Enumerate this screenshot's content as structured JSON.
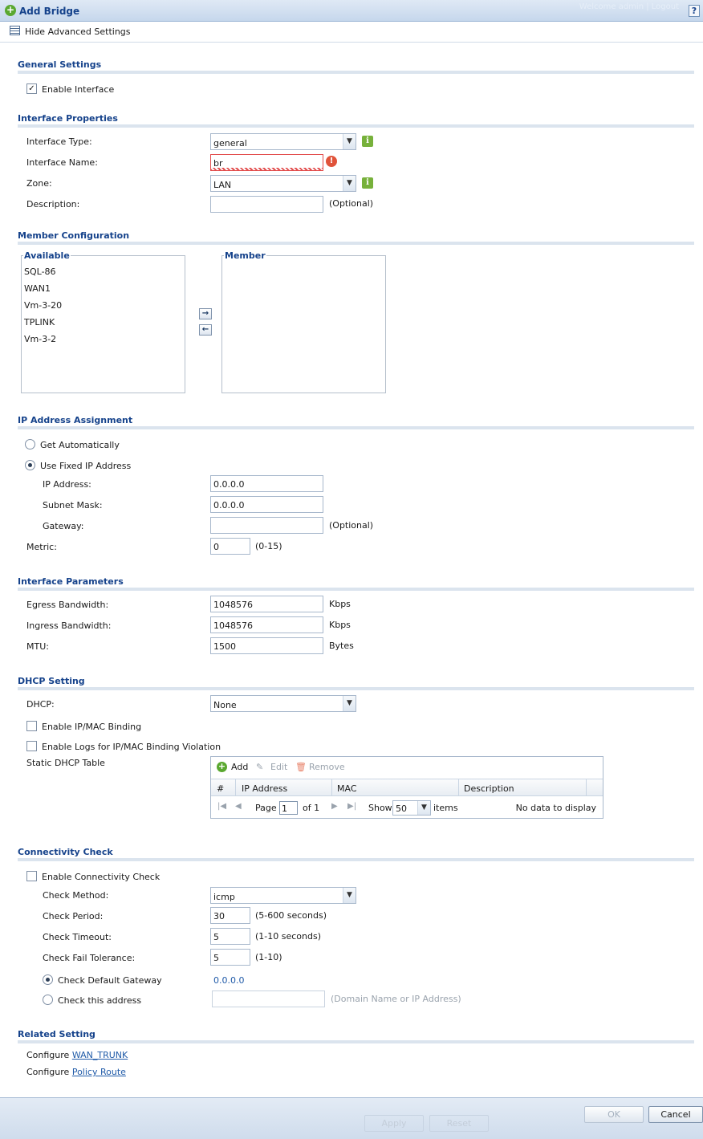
{
  "window": {
    "title": "Add Bridge",
    "help_label": "?",
    "faint_text": "Welcome admin | Logout"
  },
  "toolbar": {
    "advanced_label": "Hide Advanced Settings"
  },
  "general": {
    "title": "General Settings",
    "enable_interface": "Enable Interface",
    "enable_checked": true
  },
  "iface_props": {
    "title": "Interface Properties",
    "type_label": "Interface Type:",
    "type_value": "general",
    "name_label": "Interface Name:",
    "name_value": "br",
    "zone_label": "Zone:",
    "zone_value": "LAN",
    "desc_label": "Description:",
    "desc_value": "",
    "optional": "(Optional)"
  },
  "member": {
    "title": "Member Configuration",
    "available_label": "Available",
    "member_label": "Member",
    "available": [
      "SQL-86",
      "WAN1",
      "Vm-3-20",
      "TPLINK",
      "Vm-3-2"
    ]
  },
  "ip": {
    "title": "IP Address Assignment",
    "get_auto": "Get Automatically",
    "use_fixed": "Use Fixed IP Address",
    "ip_label": "IP Address:",
    "ip_value": "0.0.0.0",
    "mask_label": "Subnet Mask:",
    "mask_value": "0.0.0.0",
    "gw_label": "Gateway:",
    "gw_value": "",
    "gw_hint": "(Optional)",
    "metric_label": "Metric:",
    "metric_value": "0",
    "metric_hint": "(0-15)"
  },
  "params": {
    "title": "Interface Parameters",
    "egress_label": "Egress Bandwidth:",
    "egress_value": "1048576",
    "ingress_label": "Ingress Bandwidth:",
    "ingress_value": "1048576",
    "kbps": "Kbps",
    "mtu_label": "MTU:",
    "mtu_value": "1500",
    "bytes": "Bytes"
  },
  "dhcp": {
    "title": "DHCP Setting",
    "dhcp_label": "DHCP:",
    "dhcp_value": "None",
    "ipmac": "Enable IP/MAC Binding",
    "logs": "Enable Logs for IP/MAC Binding Violation",
    "static_label": "Static DHCP Table",
    "add": "Add",
    "edit": "Edit",
    "remove": "Remove",
    "columns": [
      "#",
      "IP Address",
      "MAC",
      "Description"
    ],
    "page_label": "Page",
    "page_value": "1",
    "of_label": "of 1",
    "show_label": "Show",
    "show_value": "50",
    "items_label": "items",
    "no_data": "No data to display"
  },
  "conn": {
    "title": "Connectivity Check",
    "enable": "Enable Connectivity Check",
    "method_label": "Check Method:",
    "method_value": "icmp",
    "period_label": "Check Period:",
    "period_value": "30",
    "period_hint": "(5-600 seconds)",
    "timeout_label": "Check Timeout:",
    "timeout_value": "5",
    "timeout_hint": "(1-10 seconds)",
    "fail_label": "Check Fail Tolerance:",
    "fail_value": "5",
    "fail_hint": "(1-10)",
    "default_gw": "Check Default Gateway",
    "default_gw_value": "0.0.0.0",
    "this_addr": "Check this address",
    "this_addr_hint": "(Domain Name or IP Address)"
  },
  "related": {
    "title": "Related Setting",
    "configure": "Configure",
    "link1": "WAN_TRUNK",
    "link2": "Policy Route"
  },
  "footer": {
    "apply": "Apply",
    "reset": "Reset",
    "ok": "OK",
    "cancel": "Cancel"
  },
  "colors": {
    "section_title": "#15428b",
    "accent_green": "#77b13b",
    "error_red": "#e24d4d",
    "link": "#1f5aa8"
  }
}
